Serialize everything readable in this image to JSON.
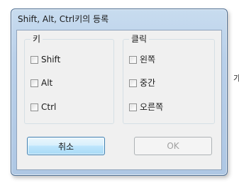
{
  "background": {
    "edge_char": "가"
  },
  "dialog": {
    "title": "Shift, Alt, Ctrl키의 등록",
    "key_group": {
      "title": "키",
      "items": [
        {
          "label": "Shift",
          "checked": false
        },
        {
          "label": "Alt",
          "checked": false
        },
        {
          "label": "Ctrl",
          "checked": false
        }
      ]
    },
    "click_group": {
      "title": "클릭",
      "items": [
        {
          "label": "왼쪽",
          "checked": false
        },
        {
          "label": "중간",
          "checked": false
        },
        {
          "label": "오른쪽",
          "checked": false
        }
      ]
    },
    "buttons": {
      "cancel_label": "취소",
      "ok_label": "OK",
      "ok_enabled": false
    }
  },
  "colors": {
    "frame": "#b9d0ea",
    "client": "#f0f0f0",
    "focused_button_border": "#3c7fb1",
    "disabled_text": "#a0a0a0"
  }
}
